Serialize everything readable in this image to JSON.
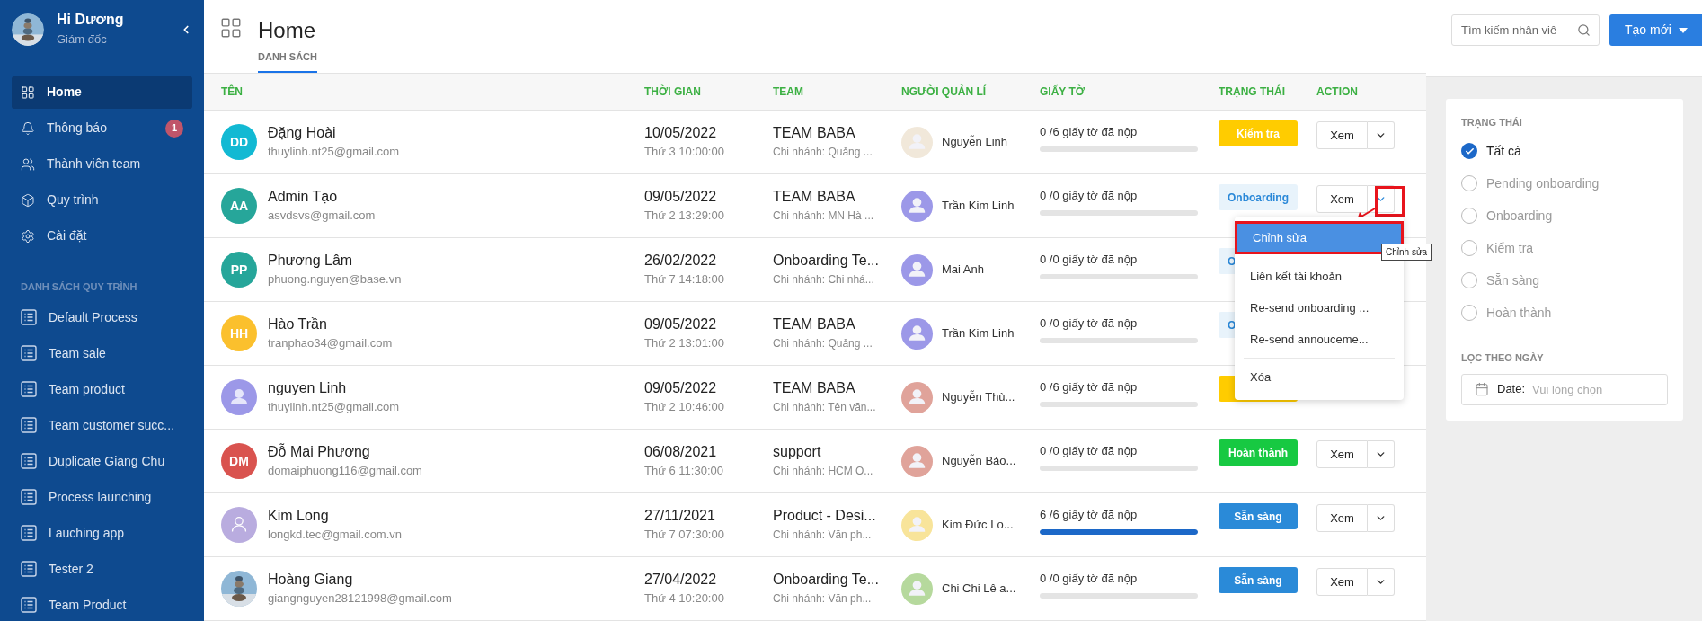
{
  "sidebar": {
    "user": {
      "name": "Hi Dương",
      "role": "Giám đốc"
    },
    "nav": [
      {
        "kind": "grid",
        "label": "Home",
        "selected": true
      },
      {
        "kind": "bell",
        "label": "Thông báo",
        "selected": false,
        "badge": "1"
      },
      {
        "kind": "users",
        "label": "Thành viên team",
        "selected": false
      },
      {
        "kind": "cube",
        "label": "Quy trình",
        "selected": false
      },
      {
        "kind": "gear",
        "label": "Cài đặt",
        "selected": false
      }
    ],
    "section_title": "DANH SÁCH QUY TRÌNH",
    "processes": [
      {
        "label": "Default Process",
        "selected": false
      },
      {
        "label": "Team sale",
        "selected": false
      },
      {
        "label": "Team product",
        "selected": false
      },
      {
        "label": "Team customer succ...",
        "selected": false
      },
      {
        "label": "Duplicate Giang Chu",
        "selected": false
      },
      {
        "label": "Process launching",
        "selected": false
      },
      {
        "label": "Lauching app",
        "selected": false
      },
      {
        "label": "Tester 2",
        "selected": false
      },
      {
        "label": "Team Product",
        "selected": false
      }
    ]
  },
  "header": {
    "title": "Home",
    "tabs": [
      {
        "label": "DANH SÁCH",
        "selected": true
      }
    ],
    "search": {
      "placeholder": "Tìm kiếm nhân viê"
    },
    "create_button": "Tạo mới"
  },
  "table": {
    "columns": [
      "TÊN",
      "THỜI GIAN",
      "TEAM",
      "NGƯỜI QUẢN LÍ",
      "GIẤY TỜ",
      "TRẠNG THÁI",
      "ACTION"
    ],
    "rows": [
      {
        "avatar": {
          "kind": "initials",
          "text": "DD",
          "color": "#12b9d3"
        },
        "name": "Đặng Hoài",
        "email": "thuylinh.nt25@gmail.com",
        "date": "10/05/2022",
        "time": "Thứ 3 10:00:00",
        "team": "TEAM BABA",
        "branch": "Chi nhánh: Quảng ...",
        "manager": {
          "name": "Nguyễn Linh",
          "color": "#f1e8da"
        },
        "documents": "0 /6 giấy tờ đã nộp",
        "level": 0,
        "status": {
          "kind": "kiem_tra",
          "label": "Kiểm tra"
        },
        "action": {
          "label": "Xem",
          "open": false
        }
      },
      {
        "avatar": {
          "kind": "initials",
          "text": "AA",
          "color": "#26a69a"
        },
        "name": "Admin Tạo",
        "email": "asvdsvs@gmail.com",
        "date": "09/05/2022",
        "time": "Thứ 2 13:29:00",
        "team": "TEAM BABA",
        "branch": "Chi nhánh: MN Hà ...",
        "manager": {
          "name": "Trần Kim Linh",
          "color": "#9c98e8"
        },
        "documents": "0 /0 giấy tờ đã nộp",
        "level": 0,
        "status": {
          "kind": "onboarding",
          "label": "Onboarding"
        },
        "action": {
          "label": "Xem",
          "open": true
        }
      },
      {
        "avatar": {
          "kind": "initials",
          "text": "PP",
          "color": "#26a69a"
        },
        "name": "Phương Lâm",
        "email": "phuong.nguyen@base.vn",
        "date": "26/02/2022",
        "time": "Thứ 7 14:18:00",
        "team": "Onboarding Te...",
        "branch": "Chi nhánh: Chi nhá...",
        "manager": {
          "name": "Mai Anh",
          "color": "#9c98e8"
        },
        "documents": "0 /0 giấy tờ đã nộp",
        "level": 0,
        "status": {
          "kind": "onboarding",
          "label": "O",
          "covered": true
        }
      },
      {
        "avatar": {
          "kind": "initials",
          "text": "HH",
          "color": "#fbc02d"
        },
        "name": "Hào Trần",
        "email": "tranphao34@gmail.com",
        "date": "09/05/2022",
        "time": "Thứ 2 13:01:00",
        "team": "TEAM BABA",
        "branch": "Chi nhánh: Quảng ...",
        "manager": {
          "name": "Trần Kim Linh",
          "color": "#9c98e8"
        },
        "documents": "0 /0 giấy tờ đã nộp",
        "level": 0,
        "status": {
          "kind": "onboarding",
          "label": "O",
          "covered": true
        }
      },
      {
        "avatar": {
          "kind": "silhouette",
          "color": "#9c98e8"
        },
        "name": "nguyen Linh",
        "email": "thuylinh.nt25@gmail.com",
        "date": "09/05/2022",
        "time": "Thứ 2 10:46:00",
        "team": "TEAM BABA",
        "branch": "Chi nhánh: Tên văn...",
        "manager": {
          "name": "Nguyễn Thù...",
          "color": "#e0a39a"
        },
        "documents": "0 /6 giấy tờ đã nộp",
        "level": 0,
        "status": {
          "kind": "kiem_tra"
        }
      },
      {
        "avatar": {
          "kind": "initials",
          "text": "DM",
          "color": "#d9534f"
        },
        "name": "Đỗ Mai Phương",
        "email": "domaiphuong116@gmail.com",
        "date": "06/08/2021",
        "time": "Thứ 6 11:30:00",
        "team": "support",
        "branch": "Chi nhánh: HCM O...",
        "manager": {
          "name": "Nguyễn Bảo...",
          "color": "#e0a39a"
        },
        "documents": "0 /0 giấy tờ đã nộp",
        "level": 0,
        "status": {
          "kind": "hoan_thanh",
          "label": "Hoàn thành"
        },
        "action": {
          "label": "Xem",
          "open": false
        }
      },
      {
        "avatar": {
          "kind": "outline",
          "color": "#b9acdf"
        },
        "name": "Kim Long",
        "email": "longkd.tec@gmail.com.vn",
        "date": "27/11/2021",
        "time": "Thứ 7 07:30:00",
        "team": "Product - Desi...",
        "branch": "Chi nhánh: Văn ph...",
        "manager": {
          "name": "Kim Đức Lo...",
          "color": "#f8e49a"
        },
        "documents": "6 /6 giấy tờ đã nộp",
        "level": 1,
        "status": {
          "kind": "san_sang",
          "label": "Sẵn sàng"
        },
        "action": {
          "label": "Xem",
          "open": false
        }
      },
      {
        "name": "Hoàng Giang",
        "email": "giangnguyen28121998@gmail.com",
        "date": "27/04/2022",
        "time": "Thứ 4 10:20:00",
        "team": "Onboarding Te...",
        "branch": "Chi nhánh: Văn ph...",
        "manager": {
          "name": "Chi Chi Lê a...",
          "color": "#b6d99d"
        },
        "documents": "0 /0 giấy tờ đã nộp",
        "level": 0,
        "status": {
          "kind": "san_sang",
          "label": "Sẵn sàng"
        },
        "action": {
          "label": "Xem",
          "open": false
        }
      }
    ]
  },
  "action_menu": {
    "items": [
      {
        "kind": "item",
        "label": "Chỉnh sửa",
        "selected": true
      },
      {
        "kind": "item",
        "label": "Liên kết tài khoản",
        "selected": false
      },
      {
        "kind": "item",
        "label": "Re-send onboarding ...",
        "selected": false
      },
      {
        "kind": "item",
        "label": "Re-send annouceme...",
        "selected": false
      },
      {
        "kind": "divider"
      },
      {
        "kind": "item",
        "label": "Xóa",
        "selected": false
      }
    ],
    "tooltip": "Chỉnh sửa"
  },
  "filter": {
    "status_title": "TRẠNG THÁI",
    "options": [
      {
        "label": "Tất cả",
        "selected": true
      },
      {
        "label": "Pending onboarding",
        "selected": false
      },
      {
        "label": "Onboarding",
        "selected": false
      },
      {
        "label": "Kiểm tra",
        "selected": false
      },
      {
        "label": "Sẵn sàng",
        "selected": false
      },
      {
        "label": "Hoàn thành",
        "selected": false
      }
    ],
    "date_title": "LỌC THEO NGÀY",
    "date_field": {
      "label": "Date:",
      "placeholder": "Vui lòng chọn"
    }
  }
}
